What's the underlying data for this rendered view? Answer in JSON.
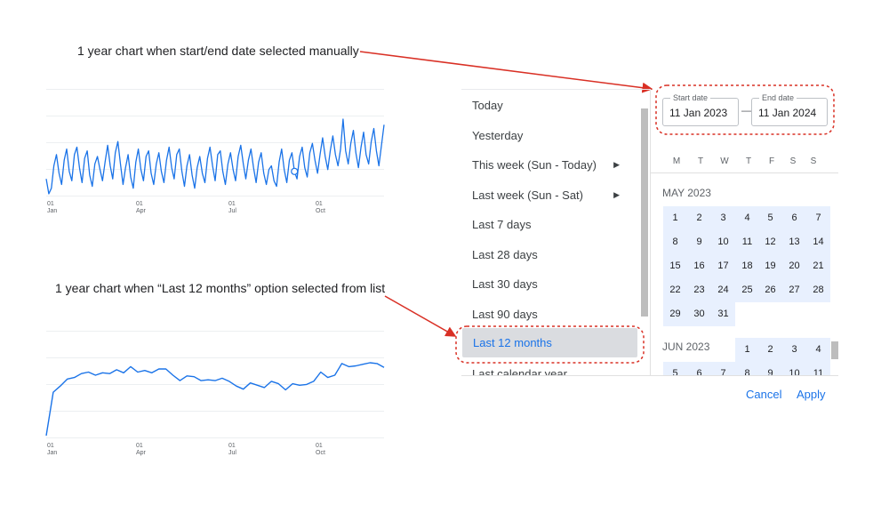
{
  "annotations": {
    "manual": "1 year chart when start/end date selected manually",
    "preset": "1 year chart when “Last 12 months” option selected from list"
  },
  "colors": {
    "accent": "#1a73e8",
    "annotation_red": "#d93025",
    "selected_day_bg": "#e8f0fe",
    "selected_preset_bg": "#dadce0"
  },
  "chart_data": [
    {
      "type": "line",
      "x_ticks": [
        {
          "day": "01",
          "month": "Jan"
        },
        {
          "day": "01",
          "month": "Apr"
        },
        {
          "day": "01",
          "month": "Jul"
        },
        {
          "day": "01",
          "month": "Oct"
        }
      ],
      "grid": true,
      "values": [
        46,
        30,
        36,
        60,
        72,
        52,
        40,
        66,
        78,
        54,
        44,
        72,
        80,
        58,
        42,
        68,
        76,
        50,
        38,
        62,
        70,
        56,
        44,
        64,
        82,
        60,
        46,
        74,
        86,
        62,
        40,
        58,
        72,
        48,
        36,
        64,
        78,
        56,
        44,
        70,
        76,
        52,
        40,
        62,
        74,
        54,
        42,
        66,
        80,
        58,
        46,
        72,
        78,
        54,
        38,
        60,
        72,
        50,
        36,
        58,
        70,
        52,
        42,
        68,
        80,
        60,
        44,
        72,
        76,
        54,
        40,
        62,
        74,
        56,
        44,
        70,
        82,
        62,
        46,
        66,
        78,
        58,
        42,
        64,
        74,
        52,
        40,
        56,
        60,
        44,
        38,
        64,
        78,
        56,
        42,
        66,
        74,
        54,
        46,
        70,
        80,
        58,
        48,
        74,
        84,
        66,
        52,
        72,
        90,
        70,
        56,
        76,
        92,
        72,
        60,
        78,
        110,
        76,
        62,
        84,
        98,
        74,
        58,
        80,
        96,
        72,
        62,
        86,
        100,
        76,
        60,
        82,
        104
      ],
      "highlight_index": 97
    },
    {
      "type": "line",
      "x_ticks": [
        {
          "day": "01",
          "month": "Jan"
        },
        {
          "day": "01",
          "month": "Apr"
        },
        {
          "day": "01",
          "month": "Jul"
        },
        {
          "day": "01",
          "month": "Oct"
        }
      ],
      "grid": true,
      "values": [
        2,
        58,
        66,
        75,
        77,
        82,
        84,
        80,
        83,
        82,
        87,
        83,
        91,
        84,
        86,
        83,
        88,
        88,
        80,
        73,
        79,
        78,
        73,
        74,
        73,
        76,
        72,
        66,
        62,
        70,
        67,
        64,
        72,
        69,
        61,
        69,
        67,
        68,
        72,
        84,
        77,
        80,
        95,
        91,
        92,
        94,
        96,
        95,
        90
      ]
    }
  ],
  "picker": {
    "presets": [
      {
        "label": "Today",
        "submenu": false
      },
      {
        "label": "Yesterday",
        "submenu": false
      },
      {
        "label": "This week (Sun - Today)",
        "submenu": true
      },
      {
        "label": "Last week (Sun - Sat)",
        "submenu": true
      },
      {
        "label": "Last 7 days",
        "submenu": false
      },
      {
        "label": "Last 28 days",
        "submenu": false
      },
      {
        "label": "Last 30 days",
        "submenu": false
      },
      {
        "label": "Last 90 days",
        "submenu": false
      },
      {
        "label": "Last 12 months",
        "submenu": false
      },
      {
        "label": "Last calendar year",
        "submenu": false
      }
    ],
    "selected_preset": "Last 12 months",
    "start_date": {
      "label": "Start date",
      "value": "11 Jan 2023"
    },
    "end_date": {
      "label": "End date",
      "value": "11 Jan 2024"
    },
    "date_separator": "—",
    "weekdays": [
      "M",
      "T",
      "W",
      "T",
      "F",
      "S",
      "S"
    ],
    "months": [
      {
        "title": "MAY 2023",
        "first_weekday": 0,
        "days": 31
      },
      {
        "title": "JUN 2023",
        "first_weekday": 3,
        "days": 11
      }
    ],
    "actions": {
      "cancel": "Cancel",
      "apply": "Apply"
    }
  }
}
